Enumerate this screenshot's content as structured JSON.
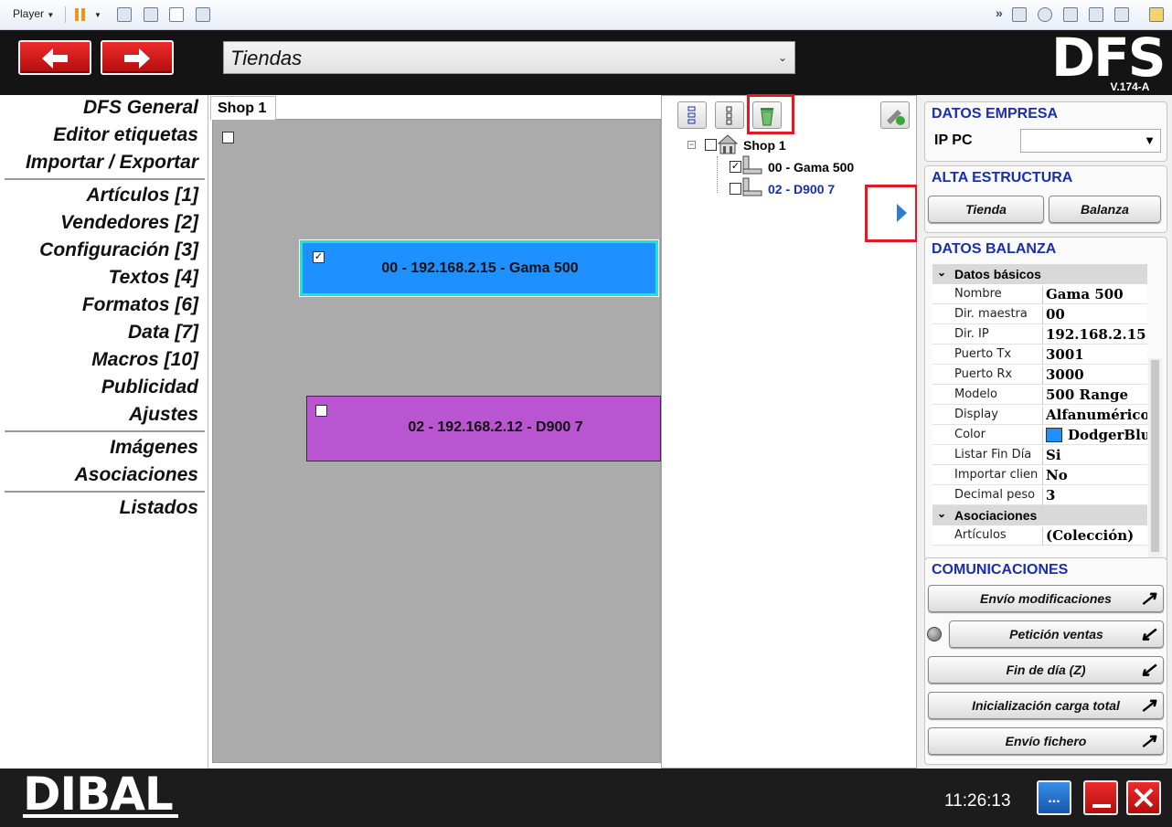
{
  "player_bar": {
    "label": "Player"
  },
  "header": {
    "back_icon": "arrow-left-icon",
    "forward_icon": "arrow-right-icon",
    "section_select_value": "Tiendas",
    "logo_text": "DFS",
    "version": "V.174-A"
  },
  "left_menu": {
    "group1": [
      "DFS General",
      "Editor etiquetas",
      "Importar / Exportar"
    ],
    "group2": [
      "Artículos [1]",
      "Vendedores [2]",
      "Configuración [3]",
      "Textos [4]",
      "Formatos [6]",
      "Data [7]",
      "Macros [10]",
      "Publicidad",
      "Ajustes"
    ],
    "group3": [
      "Imágenes",
      "Asociaciones"
    ],
    "group4": [
      "Listados"
    ]
  },
  "canvas": {
    "tab_label": "Shop 1",
    "scales": [
      {
        "label": "00 - 192.168.2.15 - Gama 500",
        "checked": true,
        "color": "#1e90ff"
      },
      {
        "label": "02 - 192.168.2.12 - D900 7",
        "checked": false,
        "color": "#b955d1"
      }
    ]
  },
  "tree": {
    "root": "Shop 1",
    "children": [
      {
        "label": "00 - Gama 500",
        "checked": true,
        "color": "#000000"
      },
      {
        "label": "02 - D900 7",
        "checked": false,
        "color": "#1a2fa8"
      }
    ]
  },
  "right_panel": {
    "datos_empresa": {
      "title": "DATOS EMPRESA",
      "ip_label": "IP PC",
      "ip_value": ""
    },
    "alta_estructura": {
      "title": "ALTA ESTRUCTURA",
      "tienda_button": "Tienda",
      "balanza_button": "Balanza"
    },
    "datos_balanza": {
      "title": "DATOS BALANZA",
      "categories": [
        {
          "name": "Datos básicos",
          "rows": [
            {
              "name": "Nombre",
              "value": "Gama 500"
            },
            {
              "name": "Dir. maestra",
              "value": "00"
            },
            {
              "name": "Dir. IP",
              "value": "192.168.2.15"
            },
            {
              "name": "Puerto Tx",
              "value": "3001"
            },
            {
              "name": "Puerto Rx",
              "value": "3000"
            },
            {
              "name": "Modelo",
              "value": "500 Range"
            },
            {
              "name": "Display",
              "value": "Alfanumérico"
            },
            {
              "name": "Color",
              "value": "DodgerBlue"
            },
            {
              "name": "Listar Fin Día",
              "value": "Si"
            },
            {
              "name": "Importar clien",
              "value": "No"
            },
            {
              "name": "Decimal peso",
              "value": "3"
            }
          ]
        },
        {
          "name": "Asociaciones",
          "rows": [
            {
              "name": "Artículos",
              "value": "(Colección)"
            }
          ]
        }
      ],
      "color_swatch": "#1e90ff"
    },
    "comunicaciones": {
      "title": "COMUNICACIONES",
      "buttons": [
        {
          "label": "Envío modificaciones",
          "icon": "arrow-up-right-icon"
        },
        {
          "label": "Petición ventas",
          "icon": "arrow-down-left-icon"
        },
        {
          "label": "Fin de día (Z)",
          "icon": "arrow-down-left-icon"
        },
        {
          "label": "Inicialización carga total",
          "icon": "arrow-up-right-icon"
        },
        {
          "label": "Envío fichero",
          "icon": "arrow-up-right-icon"
        }
      ]
    }
  },
  "footer": {
    "logo_text": "DIBAL",
    "clock": "11:26:13",
    "more_button": "...",
    "minimize_icon": "minimize-icon",
    "close_icon": "close-icon"
  },
  "colors": {
    "accent_red": "#d11414",
    "title_blue": "#1a2fa8",
    "canvas_gray": "#ababab"
  }
}
